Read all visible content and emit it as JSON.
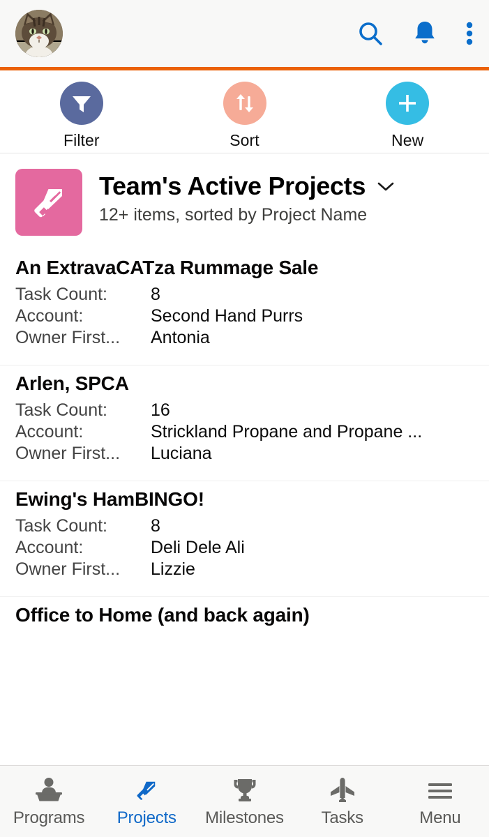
{
  "theme": {
    "brand_blue": "#1069c8",
    "accent_orange": "#eb6109",
    "filter_circle": "#5a6a9e",
    "sort_circle": "#f6ab97",
    "new_circle": "#35bde4",
    "object_icon_pink": "#e4699f",
    "header_bg": "#f8f8f7",
    "nav_inactive": "#5a5a58"
  },
  "topbar": {
    "avatar_name": "user-avatar-cat-photo",
    "search_label": "Search",
    "notifications_label": "Notifications",
    "more_label": "More"
  },
  "actions": [
    {
      "label": "Filter",
      "icon": "filter-icon"
    },
    {
      "label": "Sort",
      "icon": "sort-arrows-icon"
    },
    {
      "label": "New",
      "icon": "plus-icon"
    }
  ],
  "list_header": {
    "icon": "saw-icon",
    "title": "Team's Active Projects",
    "subtitle": "12+ items, sorted by Project Name",
    "chevron": "chevron-down-icon"
  },
  "records": [
    {
      "title": "An ExtravaCATza Rummage Sale",
      "fields": [
        {
          "label": "Task Count:",
          "value": "8"
        },
        {
          "label": "Account:",
          "value": "Second Hand Purrs"
        },
        {
          "label": "Owner First...",
          "value": "Antonia"
        }
      ]
    },
    {
      "title": "Arlen, SPCA",
      "fields": [
        {
          "label": "Task Count:",
          "value": "16"
        },
        {
          "label": "Account:",
          "value": "Strickland Propane and Propane ..."
        },
        {
          "label": "Owner First...",
          "value": "Luciana"
        }
      ]
    },
    {
      "title": "Ewing's HamBINGO!",
      "fields": [
        {
          "label": "Task Count:",
          "value": "8"
        },
        {
          "label": "Account:",
          "value": "Deli Dele Ali"
        },
        {
          "label": "Owner First...",
          "value": "Lizzie"
        }
      ]
    },
    {
      "title": "Office to Home (and back again)",
      "fields": []
    }
  ],
  "bottom_nav": {
    "active": "Projects",
    "items": [
      {
        "label": "Programs",
        "icon": "podium-person-icon"
      },
      {
        "label": "Projects",
        "icon": "saw-icon"
      },
      {
        "label": "Milestones",
        "icon": "trophy-icon"
      },
      {
        "label": "Tasks",
        "icon": "airplane-icon"
      },
      {
        "label": "Menu",
        "icon": "hamburger-menu-icon"
      }
    ]
  }
}
